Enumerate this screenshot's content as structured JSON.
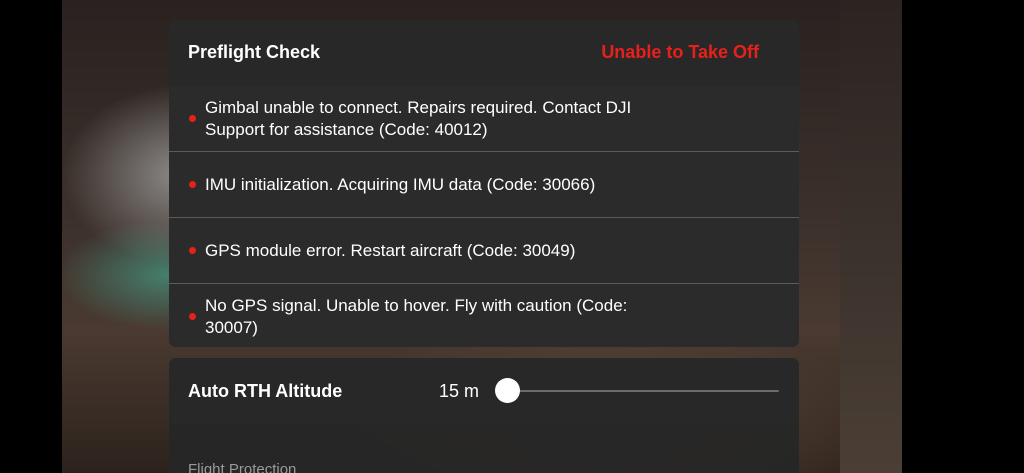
{
  "colors": {
    "error_red": "#e8201c",
    "panel_bg": "#262626",
    "text_primary": "#ffffff",
    "text_muted": "#9a9a9a",
    "slider_track": "#6b6b6b"
  },
  "preflight": {
    "title": "Preflight Check",
    "status": "Unable to Take Off",
    "warnings": [
      {
        "text": "Gimbal unable to connect. Repairs required. Contact DJI Support for assistance (Code: 40012)"
      },
      {
        "text": "IMU initialization. Acquiring IMU data (Code: 30066)"
      },
      {
        "text": "GPS module error. Restart aircraft (Code: 30049)"
      },
      {
        "text": "No GPS signal. Unable to hover. Fly with caution (Code: 30007)"
      }
    ]
  },
  "rth": {
    "label": "Auto RTH Altitude",
    "value": "15 m",
    "slider_level": 0
  },
  "flight_protection": {
    "title": "Flight Protection"
  }
}
